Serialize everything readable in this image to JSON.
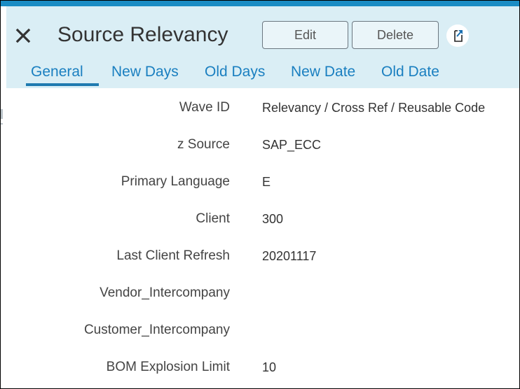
{
  "header": {
    "title": "Source Relevancy",
    "edit_label": "Edit",
    "delete_label": "Delete"
  },
  "tabs": [
    {
      "label": "General",
      "selected": true
    },
    {
      "label": "New Days",
      "selected": false
    },
    {
      "label": "Old Days",
      "selected": false
    },
    {
      "label": "New Date",
      "selected": false
    },
    {
      "label": "Old Date",
      "selected": false
    }
  ],
  "fields": [
    {
      "label": "Wave ID",
      "value": "Relevancy / Cross Ref / Reusable Code"
    },
    {
      "label": "z Source",
      "value": "SAP_ECC"
    },
    {
      "label": "Primary Language",
      "value": "E"
    },
    {
      "label": "Client",
      "value": "300"
    },
    {
      "label": "Last Client Refresh",
      "value": "20201117"
    },
    {
      "label": "Vendor_Intercompany",
      "value": ""
    },
    {
      "label": "Customer_Intercompany",
      "value": ""
    },
    {
      "label": "BOM Explosion Limit",
      "value": "10"
    }
  ],
  "colors": {
    "accent": "#1a8cc4",
    "header_bg": "#daeef5",
    "tab_text": "#1a7fc0"
  },
  "icons": {
    "close": "close-icon",
    "action": "open-in-new-icon"
  }
}
